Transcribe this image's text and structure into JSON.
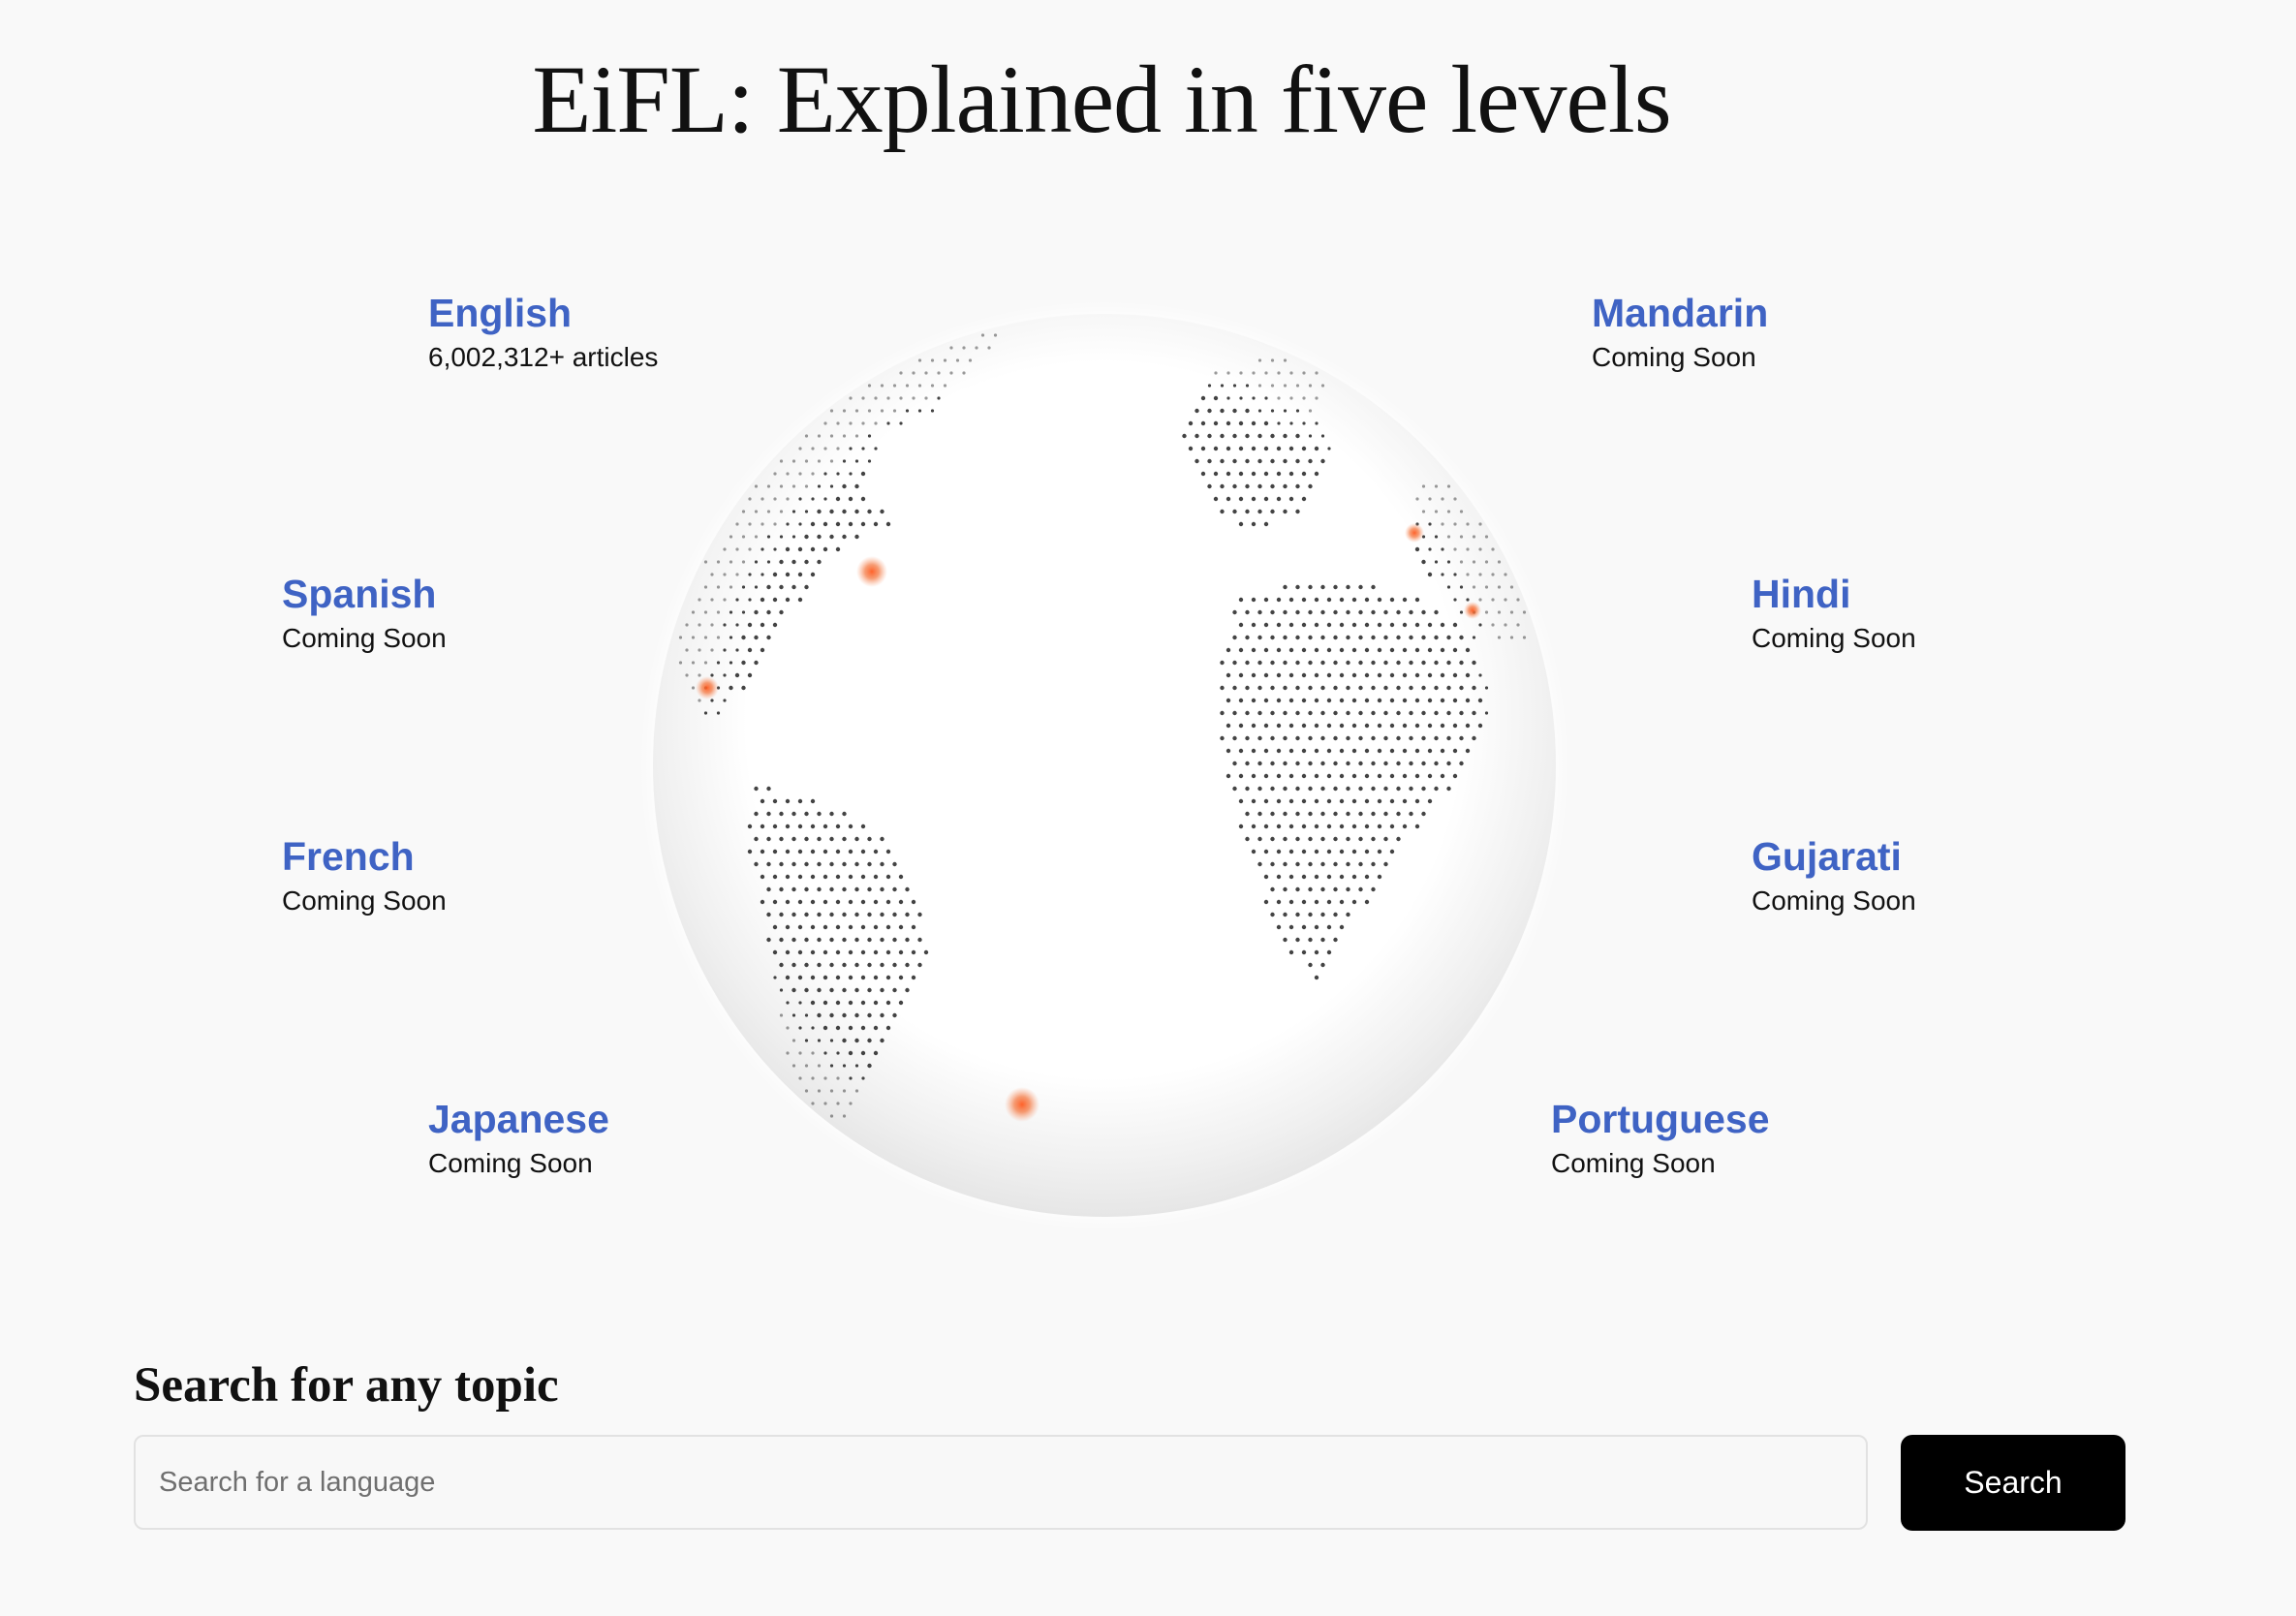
{
  "page": {
    "title": "EiFL: Explained in five levels"
  },
  "languages": [
    {
      "name": "English",
      "status": "6,002,312+ articles"
    },
    {
      "name": "Mandarin",
      "status": "Coming Soon"
    },
    {
      "name": "Spanish",
      "status": "Coming Soon"
    },
    {
      "name": "Hindi",
      "status": "Coming Soon"
    },
    {
      "name": "French",
      "status": "Coming Soon"
    },
    {
      "name": "Gujarati",
      "status": "Coming Soon"
    },
    {
      "name": "Japanese",
      "status": "Coming Soon"
    },
    {
      "name": "Portuguese",
      "status": "Coming Soon"
    }
  ],
  "search": {
    "heading": "Search for any topic",
    "placeholder": "Search for a language",
    "value": "",
    "button_label": "Search"
  },
  "colors": {
    "background": "#f9f9f9",
    "language_link": "#3f63c4",
    "button_bg": "#000000",
    "button_text": "#ffffff",
    "globe_hotspot": "#f26a2e"
  },
  "icons": {
    "globe": "dotted-world-globe-icon",
    "hotspot": "orange-glow-marker"
  }
}
